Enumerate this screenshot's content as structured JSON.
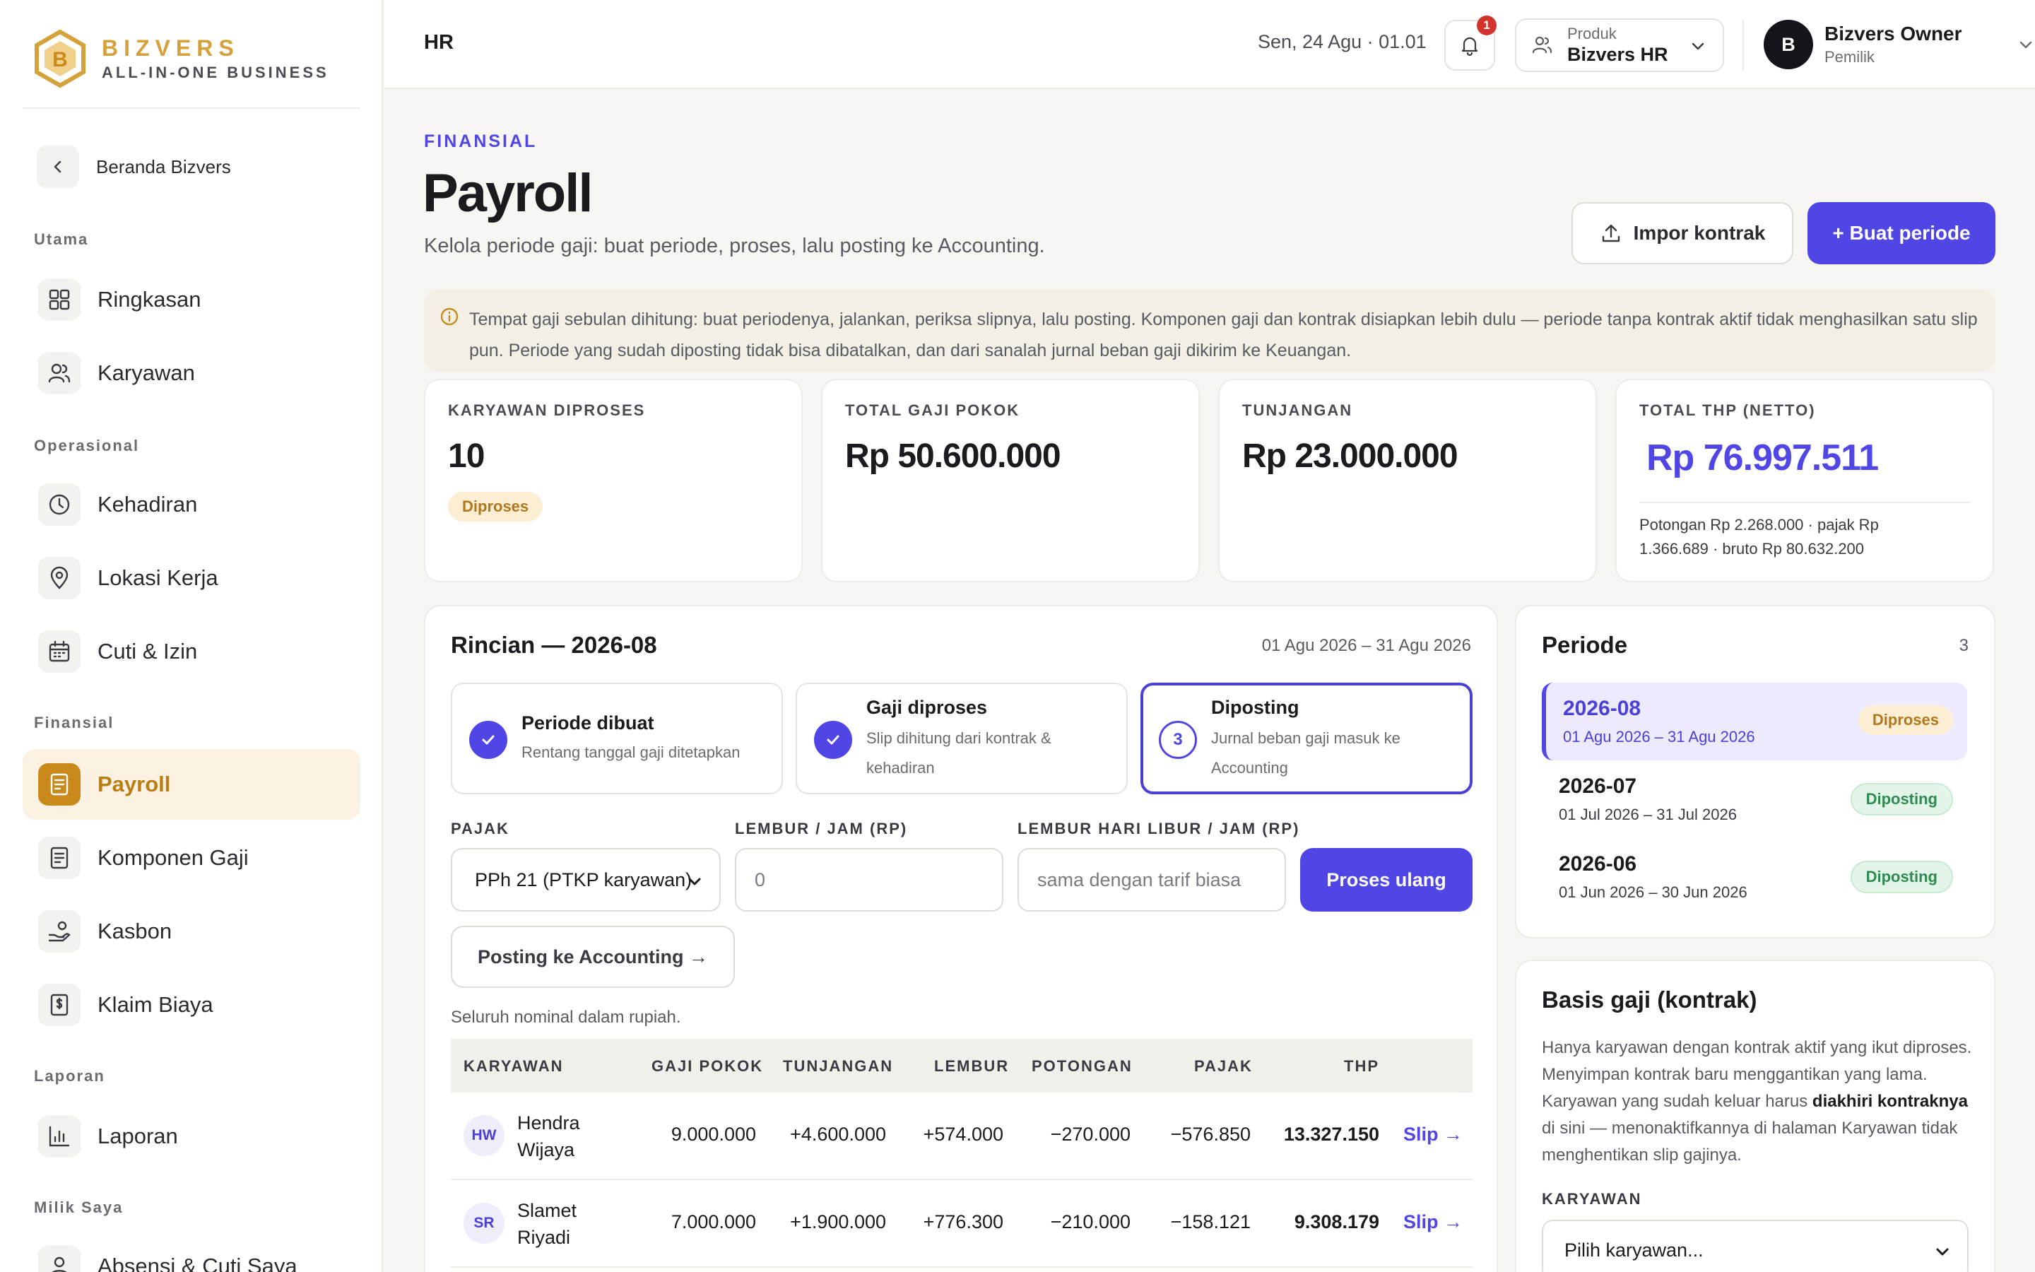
{
  "brand": {
    "name": "BIZVERS",
    "tagline": "ALL-IN-ONE BUSINESS",
    "accent": "#d5a13b"
  },
  "sidebar": {
    "back_label": "Beranda Bizvers",
    "sections": {
      "utama": "Utama",
      "operasional": "Operasional",
      "finansial": "Finansial",
      "laporan": "Laporan",
      "milik_saya": "Milik Saya"
    },
    "items": {
      "ringkasan": {
        "label": "Ringkasan",
        "icon": "grid-icon"
      },
      "karyawan": {
        "label": "Karyawan",
        "icon": "users-icon"
      },
      "kehadiran": {
        "label": "Kehadiran",
        "icon": "clock-icon"
      },
      "lokasi": {
        "label": "Lokasi Kerja",
        "icon": "map-pin-icon"
      },
      "cuti": {
        "label": "Cuti & Izin",
        "icon": "calendar-icon"
      },
      "payroll": {
        "label": "Payroll",
        "icon": "document-icon"
      },
      "komponen": {
        "label": "Komponen Gaji",
        "icon": "document-icon"
      },
      "kasbon": {
        "label": "Kasbon",
        "icon": "hand-coins-icon"
      },
      "klaim": {
        "label": "Klaim Biaya",
        "icon": "receipt-icon"
      },
      "laporan": {
        "label": "Laporan",
        "icon": "bar-chart-icon"
      },
      "absensi": {
        "label": "Absensi & Cuti Saya",
        "icon": "user-icon"
      }
    }
  },
  "topbar": {
    "title": "HR",
    "datetime": "Sen, 24 Agu · 01.01",
    "notif_count": "1",
    "product_caption": "Produk",
    "product_value": "Bizvers HR",
    "user_initial": "B",
    "user_name": "Bizvers Owner",
    "user_role": "Pemilik"
  },
  "header": {
    "eyebrow": "FINANSIAL",
    "title": "Payroll",
    "subtitle": "Kelola periode gaji: buat periode, proses, lalu posting ke Accounting.",
    "import_label": "Impor kontrak",
    "create_label": "+ Buat periode"
  },
  "info": "Tempat gaji sebulan dihitung: buat periodenya, jalankan, periksa slipnya, lalu posting. Komponen gaji dan kontrak disiapkan lebih dulu — periode tanpa kontrak aktif tidak menghasilkan satu slip pun. Periode yang sudah diposting tidak bisa dibatalkan, dan dari sanalah jurnal beban gaji dikirim ke Keuangan.",
  "stats": {
    "employees": {
      "label": "KARYAWAN DIPROSES",
      "value": "10",
      "badge": "Diproses"
    },
    "base": {
      "label": "TOTAL GAJI POKOK",
      "value": "Rp 50.600.000"
    },
    "allowance": {
      "label": "TUNJANGAN",
      "value": "Rp 23.000.000"
    },
    "thp": {
      "label": "TOTAL THP (NETTO)",
      "value": "Rp 76.997.511",
      "note": "Potongan Rp 2.268.000 · pajak Rp 1.366.689 · bruto Rp 80.632.200"
    }
  },
  "detail": {
    "title": "Rincian — 2026-08",
    "range": "01 Agu 2026 – 31 Agu 2026",
    "steps": [
      {
        "title": "Periode dibuat",
        "desc": "Rentang tanggal gaji ditetapkan"
      },
      {
        "title": "Gaji diproses",
        "desc": "Slip dihitung dari kontrak & kehadiran"
      },
      {
        "num": "3",
        "title": "Diposting",
        "desc": "Jurnal beban gaji masuk ke Accounting"
      }
    ],
    "tax_label": "PAJAK",
    "tax_value": "PPh 21 (PTKP karyawan)",
    "overtime_label": "LEMBUR / JAM (RP)",
    "overtime_value": "0",
    "holiday_label": "LEMBUR HARI LIBUR / JAM (RP)",
    "holiday_placeholder": "sama dengan tarif biasa",
    "reprocess_label": "Proses ulang",
    "posting_label": "Posting ke Accounting →",
    "note": "Seluruh nominal dalam rupiah.",
    "columns": [
      "KARYAWAN",
      "GAJI POKOK",
      "TUNJANGAN",
      "LEMBUR",
      "POTONGAN",
      "PAJAK",
      "THP"
    ],
    "rows": [
      {
        "initials": "HW",
        "name": "Hendra Wijaya",
        "base": "9.000.000",
        "allowance": "+4.600.000",
        "overtime": "+574.000",
        "deduction": "−270.000",
        "tax": "−576.850",
        "thp": "13.327.150",
        "slip": "Slip →"
      },
      {
        "initials": "SR",
        "name": "Slamet Riyadi",
        "base": "7.000.000",
        "allowance": "+1.900.000",
        "overtime": "+776.300",
        "deduction": "−210.000",
        "tax": "−158.121",
        "thp": "9.308.179",
        "slip": "Slip →"
      }
    ]
  },
  "periods": {
    "title": "Periode",
    "count": "3",
    "items": [
      {
        "code": "2026-08",
        "range": "01 Agu 2026 – 31 Agu 2026",
        "status": "Diproses"
      },
      {
        "code": "2026-07",
        "range": "01 Jul 2026 – 31 Jul 2026",
        "status": "Diposting"
      },
      {
        "code": "2026-06",
        "range": "01 Jun 2026 – 30 Jun 2026",
        "status": "Diposting"
      }
    ]
  },
  "basis": {
    "title": "Basis gaji (kontrak)",
    "text_1": "Hanya karyawan dengan kontrak aktif yang ikut diproses. Menyimpan kontrak baru menggantikan yang lama. Karyawan yang sudah keluar harus ",
    "text_bold": "diakhiri kontraknya",
    "text_2": " di sini — menonaktifkannya di halaman Karyawan tidak menghentikan slip gajinya.",
    "employee_label": "KARYAWAN",
    "employee_value": "Pilih karyawan..."
  },
  "colors": {
    "primary": "#5046e5",
    "amber": "#c98a1b",
    "green": "#2f8a51"
  }
}
